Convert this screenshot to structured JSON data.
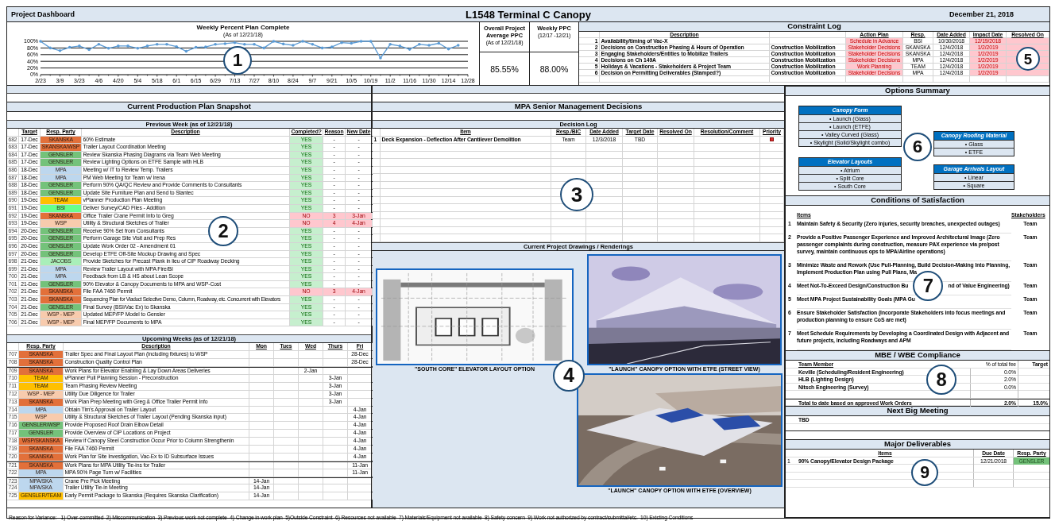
{
  "header": {
    "left": "Project Dashboard",
    "title": "L1548 Terminal C Canopy",
    "date": "December 21, 2018"
  },
  "ppc_chart": {
    "subtitle": "(As of 12/21/18)",
    "chart_data": {
      "type": "line",
      "title": "Weekly Percent Plan Complete",
      "grid": true,
      "categories": [
        "2/23",
        null,
        "3/9",
        null,
        "3/23",
        null,
        "4/6",
        null,
        "4/20",
        null,
        "5/4",
        null,
        "5/18",
        null,
        "6/1",
        null,
        "6/15",
        null,
        "6/29",
        null,
        "7/13",
        null,
        "7/27",
        null,
        "8/10",
        null,
        "8/24",
        null,
        "9/7",
        null,
        "9/21",
        null,
        "10/5",
        null,
        "10/19",
        null,
        "11/2",
        null,
        "11/16",
        null,
        "11/30",
        null,
        "12/14",
        null,
        "12/28"
      ],
      "values": [
        100,
        80,
        72,
        82,
        86,
        75,
        91,
        79,
        86,
        86,
        79,
        86,
        91,
        91,
        84,
        70,
        82,
        83,
        91,
        93,
        96,
        91,
        91,
        80,
        100,
        92,
        88,
        100,
        91,
        80,
        83,
        96,
        94,
        100,
        100,
        50,
        91,
        86,
        76,
        91,
        88,
        94,
        77,
        88,
        null
      ],
      "ylim": [
        0,
        100
      ],
      "yticks": [
        {
          "value": 0,
          "label": "0%"
        },
        {
          "value": 20,
          "label": "20%"
        },
        {
          "value": 40,
          "label": "40%"
        },
        {
          "value": 60,
          "label": "60%"
        },
        {
          "value": 80,
          "label": "80%"
        },
        {
          "value": 100,
          "label": "100%"
        }
      ]
    }
  },
  "ppc_boxes": [
    {
      "title": "Overall Project Average PPC",
      "subtitle": "(As of 12/21/18)",
      "value": "85.55%"
    },
    {
      "title": "Weekly PPC",
      "subtitle": "(12/17 -12/21)",
      "value": "88.00%"
    }
  ],
  "constraint_log": {
    "title": "Constraint Log",
    "columns": [
      "Description",
      "Action Plan",
      "Resp.",
      "Date Added",
      "Impact Date",
      "Resolved On"
    ],
    "rows": [
      {
        "num": "1",
        "description": "Availability/timing of Vac-X",
        "action_plan": "Schedule in Advance",
        "resp": "BSI",
        "date_added": "10/30/2018",
        "impact_date": "12/19/2018"
      },
      {
        "num": "2",
        "description": "Decisions on Construction Phasing & Hours of Operation",
        "category": "Construction Mobilization",
        "action_plan": "Stakeholder Decisions",
        "resp": "SKANSKA",
        "date_added": "12/4/2018",
        "impact_date": "1/2/2019"
      },
      {
        "num": "3",
        "description": "Engaging Stakeholders/Entities to Mobilize Trailers",
        "category": "Construction Mobilization",
        "action_plan": "Stakeholder Decisions",
        "resp": "SKANSKA",
        "date_added": "12/4/2018",
        "impact_date": "1/2/2019"
      },
      {
        "num": "4",
        "description": "Decisions on Ch 149A",
        "category": "Construction Mobilization",
        "action_plan": "Stakeholder Decisions",
        "resp": "MPA",
        "date_added": "12/4/2018",
        "impact_date": "1/2/2019"
      },
      {
        "num": "5",
        "description": "Holidays & Vacations - Stakeholders & Project Team",
        "category": "Construction Mobilization",
        "action_plan": "Work Planning",
        "resp": "TEAM",
        "date_added": "12/4/2018",
        "impact_date": "1/2/2019"
      },
      {
        "num": "6",
        "description": "Decision on Permitting Deliverables (Stamped?)",
        "category": "Construction Mobilization",
        "action_plan": "Stakeholder Decisions",
        "resp": "MPA",
        "date_added": "12/4/2018",
        "impact_date": "1/2/2019"
      }
    ]
  },
  "snapshot": {
    "title": "Current Production Plan Snapshot",
    "previous_week": {
      "title": "Previous Week (as of 12/21/18)",
      "columns": [
        "Target",
        "Resp. Party",
        "Description",
        "Completed?",
        "Reason",
        "New Date"
      ],
      "rows": [
        {
          "num": "682",
          "target": "17-Dec",
          "party": "SKANSKA",
          "color": "#e2703a",
          "description": "60% Estimate",
          "completed": "YES",
          "done": true,
          "reason": "-",
          "new_date": "-"
        },
        {
          "num": "683",
          "target": "17-Dec",
          "party": "SKANSKA/WSP",
          "color": "#e2703a",
          "description": "Trailer Layout Coordination Meeting",
          "completed": "YES",
          "done": true,
          "reason": "-",
          "new_date": "-"
        },
        {
          "num": "684",
          "target": "17-Dec",
          "party": "GENSLER",
          "color": "#74c27a",
          "description": "Review Skanska Phasing Diagrams via Team Web Meeting",
          "completed": "YES",
          "done": true,
          "reason": "-",
          "new_date": "-"
        },
        {
          "num": "685",
          "target": "17-Dec",
          "party": "GENSLER",
          "color": "#74c27a",
          "description": "Review Lighting Options on ETFE Sample with HLB",
          "completed": "YES",
          "done": true,
          "reason": "-",
          "new_date": "-"
        },
        {
          "num": "686",
          "target": "18-Dec",
          "party": "MPA",
          "color": "#bdd7ee",
          "description": "Meeting w/ IT to Review Temp. Trailers",
          "completed": "YES",
          "done": true,
          "reason": "-",
          "new_date": "-"
        },
        {
          "num": "687",
          "target": "18-Dec",
          "party": "MPA",
          "color": "#bdd7ee",
          "description": "PM Web Meeting for Team w/ Irena",
          "completed": "YES",
          "done": true,
          "reason": "-",
          "new_date": "-"
        },
        {
          "num": "688",
          "target": "18-Dec",
          "party": "GENSLER",
          "color": "#74c27a",
          "description": "Perform 90% QA/QC Review and Provide Comments to Consultants",
          "completed": "YES",
          "done": true,
          "reason": "-",
          "new_date": "-"
        },
        {
          "num": "689",
          "target": "18-Dec",
          "party": "GENSLER",
          "color": "#74c27a",
          "description": "Update Site Furniture Plan and Send to Stantec",
          "completed": "YES",
          "done": true,
          "reason": "-",
          "new_date": "-"
        },
        {
          "num": "690",
          "target": "19-Dec",
          "party": "TEAM",
          "color": "#ffc000",
          "description": "vPlanner Production Plan Meeting",
          "completed": "YES",
          "done": true,
          "reason": "-",
          "new_date": "-"
        },
        {
          "num": "691",
          "target": "19-Dec",
          "party": "BSI",
          "color": "#66ff8c",
          "description": "Deliver Survey/CAD Files - Addition",
          "completed": "YES",
          "done": true,
          "reason": "-",
          "new_date": "-"
        },
        {
          "num": "692",
          "target": "19-Dec",
          "party": "SKANSKA",
          "color": "#e2703a",
          "description": "Office Trailer Crane Permit Info to Greg",
          "completed": "NO",
          "done": false,
          "reason": "3",
          "new_date": "3-Jan"
        },
        {
          "num": "693",
          "target": "19-Dec",
          "party": "WSP",
          "color": "#f8cbad",
          "description": "Utility & Structural Sketches of Trailer",
          "completed": "NO",
          "done": false,
          "reason": "4",
          "new_date": "4-Jan"
        },
        {
          "num": "694",
          "target": "20-Dec",
          "party": "GENSLER",
          "color": "#74c27a",
          "description": "Receive 90% Set from Consultants",
          "completed": "YES",
          "done": true,
          "reason": "-",
          "new_date": "-"
        },
        {
          "num": "695",
          "target": "20-Dec",
          "party": "GENSLER",
          "color": "#74c27a",
          "description": "Perform Garage Site Visit and Prep Res",
          "completed": "YES",
          "done": true,
          "reason": "-",
          "new_date": "-"
        },
        {
          "num": "696",
          "target": "20-Dec",
          "party": "GENSLER",
          "color": "#74c27a",
          "description": "Update Work Order 02 - Amendment 01",
          "completed": "YES",
          "done": true,
          "reason": "-",
          "new_date": "-"
        },
        {
          "num": "697",
          "target": "20-Dec",
          "party": "GENSLER",
          "color": "#74c27a",
          "description": "Develop ETFE Off-Site Mockup Drawing and Spec",
          "completed": "YES",
          "done": true,
          "reason": "-",
          "new_date": "-"
        },
        {
          "num": "698",
          "target": "21-Dec",
          "party": "JACOBS",
          "color": "#a9efb9",
          "description": "Provide Sketches for Precast Plank in lieu of CIP Roadway Decking",
          "completed": "YES",
          "done": true,
          "reason": "-",
          "new_date": "-"
        },
        {
          "num": "699",
          "target": "21-Dec",
          "party": "MPA",
          "color": "#bdd7ee",
          "description": "Review Trailer Layout with MPA Fire/BI",
          "completed": "YES",
          "done": true,
          "reason": "-",
          "new_date": "-"
        },
        {
          "num": "700",
          "target": "21-Dec",
          "party": "MPA",
          "color": "#bdd7ee",
          "description": "Feedback from LB & HS about Lean Scope",
          "completed": "YES",
          "done": true,
          "reason": "-",
          "new_date": "-"
        },
        {
          "num": "701",
          "target": "21-Dec",
          "party": "GENSLER",
          "color": "#74c27a",
          "description": "90% Elevator & Canopy Documents to MPA and WSP-Cost",
          "completed": "YES",
          "done": true,
          "reason": "-",
          "new_date": "-"
        },
        {
          "num": "702",
          "target": "21-Dec",
          "party": "SKANSKA",
          "color": "#e2703a",
          "description": "File FAA 7460 Permit",
          "completed": "NO",
          "done": false,
          "reason": "3",
          "new_date": "4-Jan"
        },
        {
          "num": "703",
          "target": "21-Dec",
          "party": "SKANSKA",
          "color": "#e2703a",
          "description": "Sequencing Plan for Viaduct Selective Demo, Column, Roadway, etc. Concurrent with Elevators",
          "fine_print": true,
          "completed": "YES",
          "done": true,
          "reason": "-",
          "new_date": "-"
        },
        {
          "num": "704",
          "target": "21-Dec",
          "party": "GENSLER",
          "color": "#74c27a",
          "description": "Final Survey (BSI/Vac Ex) to Skanska",
          "completed": "YES",
          "done": true,
          "reason": "-",
          "new_date": "-"
        },
        {
          "num": "705",
          "target": "21-Dec",
          "party": "WSP - MEP",
          "color": "#f8cbad",
          "description": "Updated MEP/FP Model to Gensler",
          "completed": "YES",
          "done": true,
          "reason": "-",
          "new_date": "-"
        },
        {
          "num": "706",
          "target": "21-Dec",
          "party": "WSP - MEP",
          "color": "#f8cbad",
          "description": "Final MEP/FP Documents to MPA",
          "completed": "YES",
          "done": true,
          "reason": "-",
          "new_date": "-"
        }
      ]
    },
    "upcoming_weeks": {
      "title": "Upcoming Weeks (as of 12/21/18)",
      "columns": [
        "Resp. Party",
        "Description",
        "Mon",
        "Tues",
        "Wed",
        "Thurs",
        "Fri"
      ],
      "rows": [
        {
          "num": "707",
          "party": "SKANSKA",
          "color": "#e2703a",
          "description": "Trailer Spec and Final Layout Plan (including fixtures) to WSP",
          "days": {
            "fri": "28-Dec"
          },
          "week_start": false
        },
        {
          "num": "708",
          "party": "SKANSKA",
          "color": "#e2703a",
          "description": "Construction Quality Control Plan",
          "days": {
            "fri": "28-Dec"
          },
          "week_start": false
        },
        {
          "num": "709",
          "party": "SKANSKA",
          "color": "#e2703a",
          "description": "Work Plans for Elevator Enabling & Lay Down Areas Deliveries",
          "days": {
            "wed": "2-Jan"
          },
          "week_start": true
        },
        {
          "num": "710",
          "party": "TEAM",
          "color": "#ffc000",
          "description": "vPlanner Pull Planning Session - Preconstruction",
          "days": {
            "thurs": "3-Jan"
          },
          "week_start": false
        },
        {
          "num": "711",
          "party": "TEAM",
          "color": "#ffc000",
          "description": "Team Phasing Review Meeting",
          "days": {
            "thurs": "3-Jan"
          },
          "week_start": false
        },
        {
          "num": "712",
          "party": "WSP - MEP",
          "color": "#f8cbad",
          "description": "Utility Due Diligence for Trailer",
          "days": {
            "thurs": "3-Jan"
          },
          "week_start": false
        },
        {
          "num": "713",
          "party": "SKANSKA",
          "color": "#e2703a",
          "description": "Work Plan Prep Meeting with Greg & Office Trailer Permit Info",
          "days": {
            "thurs": "3-Jan"
          },
          "week_start": false
        },
        {
          "num": "714",
          "party": "MPA",
          "color": "#bdd7ee",
          "description": "Obtain Tim's Approval on Trailer Layout",
          "days": {
            "fri": "4-Jan"
          },
          "week_start": false
        },
        {
          "num": "715",
          "party": "WSP",
          "color": "#f8cbad",
          "description": "Utility & Structural Sketches of Trailer Layout (Pending Skanska input)",
          "days": {
            "fri": "4-Jan"
          },
          "week_start": false
        },
        {
          "num": "716",
          "party": "GENSLER/WSP",
          "color": "#74c27a",
          "description": "Provide Proposed Roof Drain Elbow Detail",
          "days": {
            "fri": "4-Jan"
          },
          "week_start": false
        },
        {
          "num": "717",
          "party": "GENSLER",
          "color": "#74c27a",
          "description": "Provide Overview of CIP Locations on Project",
          "days": {
            "fri": "4-Jan"
          },
          "week_start": false
        },
        {
          "num": "718",
          "party": "WSP/SKANSKA",
          "color": "#e2703a",
          "description": "Review if Canopy Steel Construction Occur Prior to Column Strengthenin",
          "days": {
            "fri": "4-Jan"
          },
          "week_start": false
        },
        {
          "num": "719",
          "party": "SKANSKA",
          "color": "#e2703a",
          "description": "File FAA 7460 Permit",
          "days": {
            "fri": "4-Jan"
          },
          "week_start": false
        },
        {
          "num": "720",
          "party": "SKANSKA",
          "color": "#e2703a",
          "description": "Work Plan for Site Investigation, Vac-Ex to ID Subsurface Issues",
          "days": {
            "fri": "4-Jan"
          },
          "week_start": false
        },
        {
          "num": "721",
          "party": "SKANSKA",
          "color": "#e2703a",
          "description": "Work Plans for MPA Utility Tie-ins for Trailer",
          "days": {
            "fri": "11-Jan"
          },
          "week_start": true
        },
        {
          "num": "722",
          "party": "MPA",
          "color": "#bdd7ee",
          "description": "MPA 90% Page Turn w/ Facilities",
          "days": {
            "fri": "11-Jan"
          },
          "week_start": false
        },
        {
          "num": "723",
          "party": "MPA/SKA",
          "color": "#bdd7ee",
          "description": "Crane Pre Pick Meeting",
          "days": {
            "mon": "14-Jan"
          },
          "week_start": true
        },
        {
          "num": "724",
          "party": "MPA/SKA",
          "color": "#bdd7ee",
          "description": "Trailer Utility Tie-in Meeting",
          "days": {
            "mon": "14-Jan"
          },
          "week_start": false
        },
        {
          "num": "725",
          "party": "GENSLER/TEAM",
          "color": "#ffc000",
          "description": "Early Permit Package to Skanska (Requires Skanska Clarification)",
          "days": {
            "mon": "14-Jan"
          },
          "week_start": false
        }
      ]
    }
  },
  "decisions": {
    "title": "MPA Senior Management Decisions",
    "log_title": "Decision Log",
    "columns": [
      "Item",
      "Resp./BIC",
      "Date Added",
      "Target Date",
      "Resolved On",
      "Resolution/Comment",
      "Priority"
    ],
    "rows": [
      {
        "num": "1",
        "item": "Deck Expansion - Deflection After Cantilever Demolition",
        "resp": "Team",
        "date_added": "12/3/2018",
        "target_date": "TBD",
        "flagged": true
      }
    ],
    "drawings_title": "Current Project Drawings / Renderings",
    "drawings": [
      {
        "kind": "picture",
        "caption": "\"SOUTH CORE\" ELEVATOR LAYOUT OPTION"
      },
      {
        "kind": "picture",
        "caption": "\"LAUNCH\" CANOPY OPTION WITH ETFE (STREET VIEW)"
      },
      {
        "kind": "picture",
        "caption": "\"LAUNCH\" CANOPY OPTION WITH ETFE (OVERVIEW)"
      }
    ]
  },
  "options": {
    "title": "Options Summary",
    "groups": [
      {
        "title": "Canopy Form",
        "items": [
          "• Launch (Glass)",
          "• Launch (ETFE)",
          "• Valley Curved (Glass)",
          "• Skylight (Solid/Skylight combo)"
        ]
      },
      {
        "title": "Elevator Layouts",
        "items": [
          "• Atrium",
          "• Split Core",
          "• South Core"
        ]
      },
      {
        "title": "Canopy Roofing Material",
        "items": [
          "• Glass",
          "• ETFE"
        ]
      },
      {
        "title": "Garage Arrivals Layout",
        "items": [
          "• Linear",
          "• Square"
        ]
      }
    ]
  },
  "conditions": {
    "title": "Conditions of Satisfaction",
    "columns": [
      "Items",
      "Stakeholders"
    ],
    "items": [
      {
        "num": "1",
        "text": "Maintain Safety & Security (Zero injuries, security breaches, unexpected outages)",
        "stakeholder": "Team"
      },
      {
        "num": "2",
        "text": "Provide a Positive Passenger Experience and Improved Architectural Image (Zero passenger complaints during construction, measure PAX experience via pre/post survey, maintain continuous ops to MPA/Airline operations)",
        "stakeholder": "Team"
      },
      {
        "num": "3",
        "text": "Minimize Waste and Rework (Use Pull-Planning, Build Decision-Making Into Planning, Implement Production Plan using Pull Plans, Ma",
        "stakeholder": "Team"
      },
      {
        "num": "4",
        "text": "Meet Not-To-Exceed Design/Construction Bu",
        "tail": "nd of Value Engineering)",
        "stakeholder": "Team"
      },
      {
        "num": "5",
        "text": "Meet MPA Project Sustainability Goals (MPA Gu",
        "stakeholder": "Team"
      },
      {
        "num": "6",
        "text": "Ensure Stakeholder Satisfaction (Incorporate Stakeholders into focus meetings and production planning to ensure CoS are met)",
        "stakeholder": "Team"
      },
      {
        "num": "7",
        "text": "Meet Schedule Requirements by Developing a Coordinated Design with Adjacent and future projects, including Roadways and APM",
        "stakeholder": "Team"
      }
    ]
  },
  "mbe": {
    "title": "MBE / WBE Compliance",
    "columns": [
      "Team Member",
      "% of total fee",
      "Target"
    ],
    "rows": [
      {
        "member": "Keville (Scheduling/Resident Engineering)",
        "fee": "0.0%"
      },
      {
        "member": "HLB (Lighting Design)",
        "fee": "2.0%"
      },
      {
        "member": "Nitsch Engineering (Survey)",
        "fee": "0.0%"
      }
    ],
    "total": {
      "label": "Total to date based on approved Work Orders",
      "fee": "2.0%",
      "target": "15.0%"
    }
  },
  "next_meeting": {
    "title": "Next Big Meeting",
    "text": "TBD"
  },
  "deliverables": {
    "title": "Major Deliverables",
    "columns": [
      "Items",
      "Due Date",
      "Resp. Party"
    ],
    "rows": [
      {
        "num": "1",
        "item": "90% Canopy/Elevator Design Package",
        "due": "12/21/2018",
        "party": "GENSLER",
        "color": "#74c27a"
      }
    ]
  },
  "footer": "Reason for Variance:   1) Over-committed  2) Miscommunication  3) Previous work not complete  4) Change in work plan  5)Outside Constraint  6) Resources not available  7) Materials/Equipment not available  8) Safety concern  9) Work not authorized by contract/submittal/etc.  10) Existing Conditions",
  "callouts": [
    {
      "label": "1"
    },
    {
      "label": "2"
    },
    {
      "label": "3"
    },
    {
      "label": "4"
    },
    {
      "label": "5"
    },
    {
      "label": "6"
    },
    {
      "label": "7"
    },
    {
      "label": "8"
    },
    {
      "label": "9"
    }
  ]
}
